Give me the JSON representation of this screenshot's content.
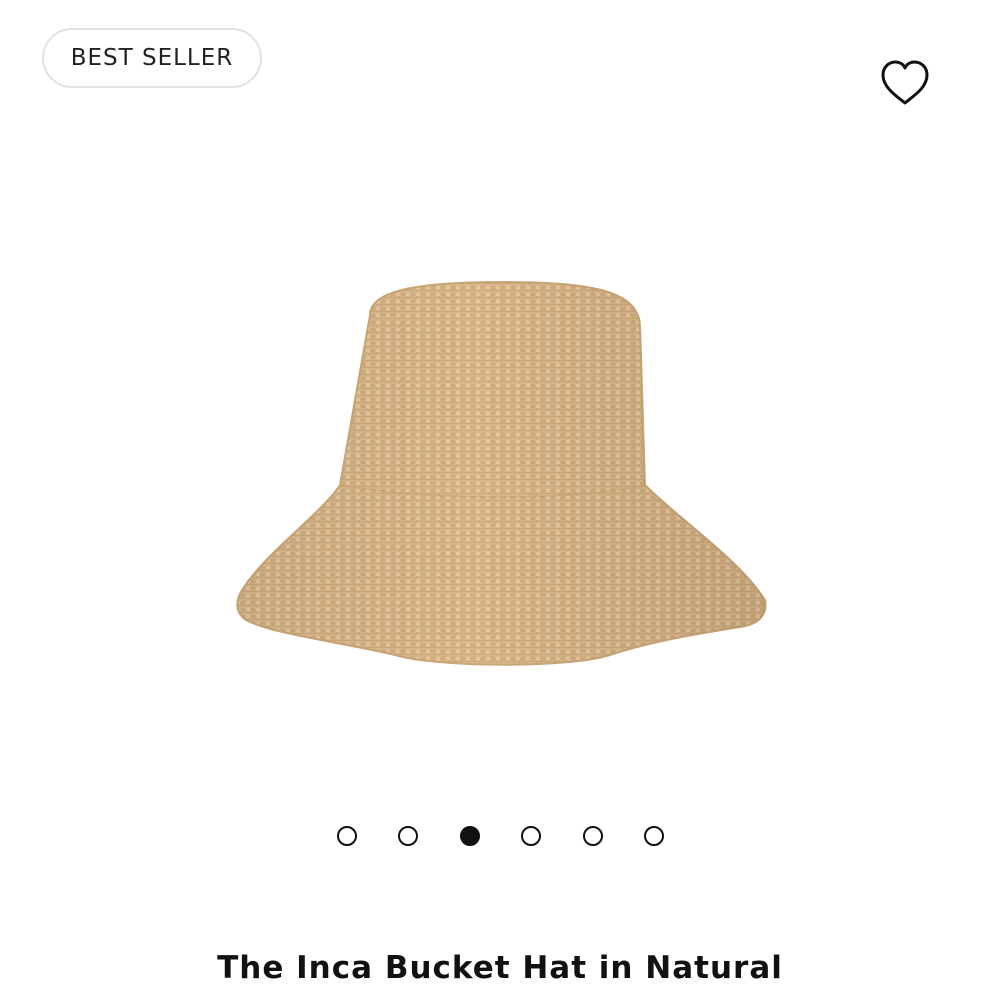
{
  "badge": {
    "label": "BEST SELLER"
  },
  "wishlist": {
    "icon": "heart-outline-icon"
  },
  "product": {
    "title": "The Inca Bucket Hat in Natural",
    "image_alt": "Straw bucket hat",
    "hat_color": "#dcba8d"
  },
  "carousel": {
    "count": 6,
    "active_index": 2
  }
}
